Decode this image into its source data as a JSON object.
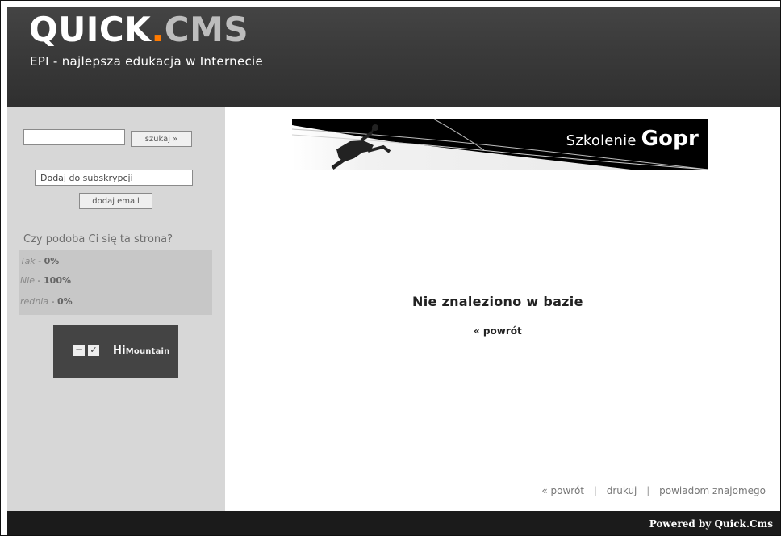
{
  "header": {
    "logo_quick": "QUICK",
    "logo_dot": ".",
    "logo_cms": "CMS",
    "tagline": "EPI - najlepsza edukacja w Internecie"
  },
  "sidebar": {
    "search": {
      "value": "",
      "button": "szukaj »"
    },
    "subscription": {
      "input_value": "Dodaj do subskrypcji",
      "button": "dodaj email"
    },
    "poll": {
      "title": "Czy podoba Ci się ta strona?",
      "options": [
        {
          "label": "Tak",
          "sep": " - ",
          "value": "0%"
        },
        {
          "label": "Nie",
          "sep": " - ",
          "value": "100%"
        },
        {
          "label": "rednia",
          "sep": " - ",
          "value": "0%"
        }
      ]
    },
    "sponsor": {
      "minus": "−",
      "check": "✓",
      "brand_main": "Hi",
      "brand_sub": "Mountain"
    }
  },
  "content": {
    "banner": {
      "title_light": "Szkolenie ",
      "title_bold": "Gopr"
    },
    "message": "Nie znaleziono w bazie",
    "back": "« powrót",
    "footer_links": {
      "back": "« powrót",
      "separator": "|",
      "print": "drukuj",
      "notify": "powiadom znajomego"
    }
  },
  "bottom": {
    "powered": "Powered by Quick.Cms"
  },
  "colors": {
    "header": "#333333",
    "sidebar": "#d7d7d7",
    "accent": "#ff7a00",
    "bottom_bar": "#1b1b1b"
  }
}
